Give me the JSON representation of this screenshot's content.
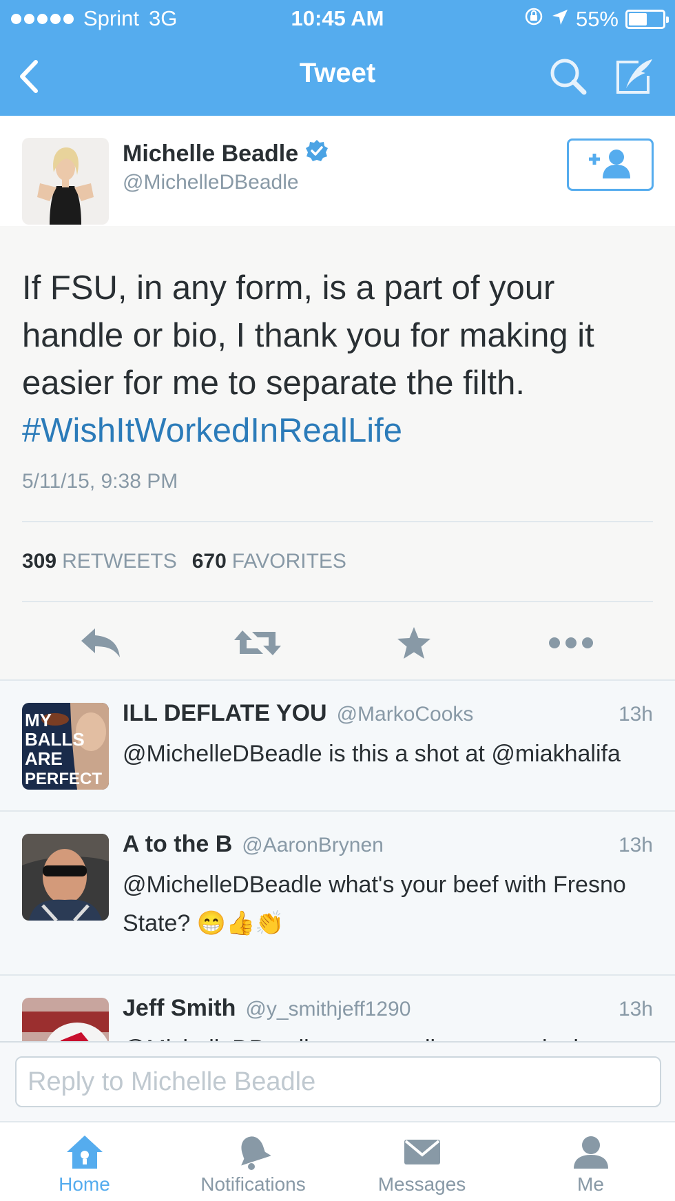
{
  "status_bar": {
    "carrier": "Sprint",
    "network": "3G",
    "time": "10:45 AM",
    "battery": "55%",
    "battery_level": 0.55
  },
  "nav": {
    "title": "Tweet",
    "back_icon": "chevron-left-icon",
    "search_icon": "search-icon",
    "compose_icon": "compose-icon"
  },
  "tweet": {
    "author_name": "Michelle Beadle",
    "author_handle": "@MichelleDBeadle",
    "verified_icon": "verified-badge-icon",
    "text": "If FSU, in any form, is a part of your handle or bio, I thank you for making it easier for me to separate the filth.",
    "hashtag": "#WishItWorkedInRealLife",
    "date": "5/11/15, 9:38 PM",
    "retweets_count": "309",
    "retweets_label": "RETWEETS",
    "favorites_count": "670",
    "favorites_label": "FAVORITES"
  },
  "replies": [
    {
      "name": "ILL DEFLATE YOU",
      "handle": "@MarkoCooks",
      "time": "13h",
      "text": "@MichelleDBeadle is this a shot at @miakhalifa",
      "avatar_text": [
        "MY",
        "BALLS",
        "ARE",
        "PERFECT"
      ]
    },
    {
      "name": "A to the B",
      "handle": "@AaronBrynen",
      "time": "13h",
      "text": "@MichelleDBeadle what's your beef with Fresno State? 😁👍👏"
    },
    {
      "name": "Jeff Smith",
      "handle": "@y_smithjeff1290",
      "time": "13h",
      "text": "@MichelleDBeadle yup penalize every single"
    }
  ],
  "reply_box": {
    "placeholder": "Reply to Michelle Beadle"
  },
  "tabs": [
    {
      "label": "Home",
      "icon": "home-icon",
      "active": true
    },
    {
      "label": "Notifications",
      "icon": "bell-icon",
      "active": false
    },
    {
      "label": "Messages",
      "icon": "envelope-icon",
      "active": false
    },
    {
      "label": "Me",
      "icon": "person-icon",
      "active": false
    }
  ],
  "colors": {
    "brand": "#55acee",
    "link": "#2b7bb9",
    "muted": "#8899a6",
    "text": "#292f33"
  }
}
